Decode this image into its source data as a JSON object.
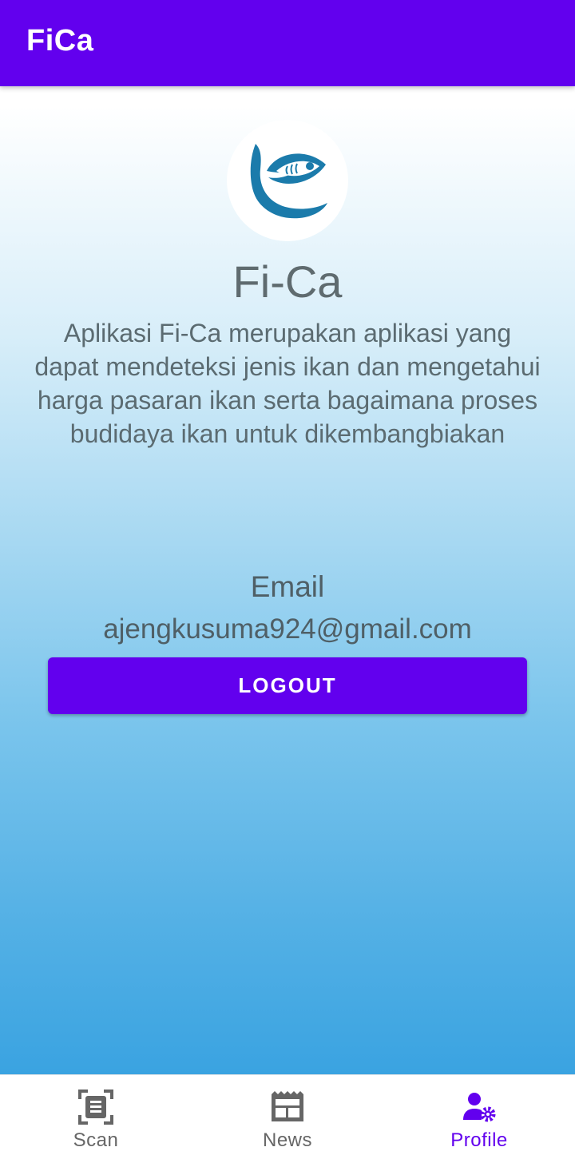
{
  "appbar": {
    "title": "FiCa"
  },
  "profile": {
    "logo_icon": "fish-logo-icon",
    "app_name": "Fi-Ca",
    "description": "Aplikasi Fi-Ca merupakan aplikasi yang dapat mendeteksi jenis ikan dan mengetahui harga pasaran ikan serta bagaimana proses budidaya ikan untuk dikembangbiakan",
    "email_label": "Email",
    "email_value": "ajengkusuma924@gmail.com",
    "logout_label": "LOGOUT"
  },
  "bottom_nav": {
    "items": [
      {
        "label": "Scan",
        "icon": "scan-icon",
        "active": false
      },
      {
        "label": "News",
        "icon": "news-icon",
        "active": false
      },
      {
        "label": "Profile",
        "icon": "profile-settings-icon",
        "active": true
      }
    ]
  },
  "colors": {
    "primary": "#6200ee",
    "logo_blue": "#1b7bab",
    "inactive": "#666666"
  }
}
